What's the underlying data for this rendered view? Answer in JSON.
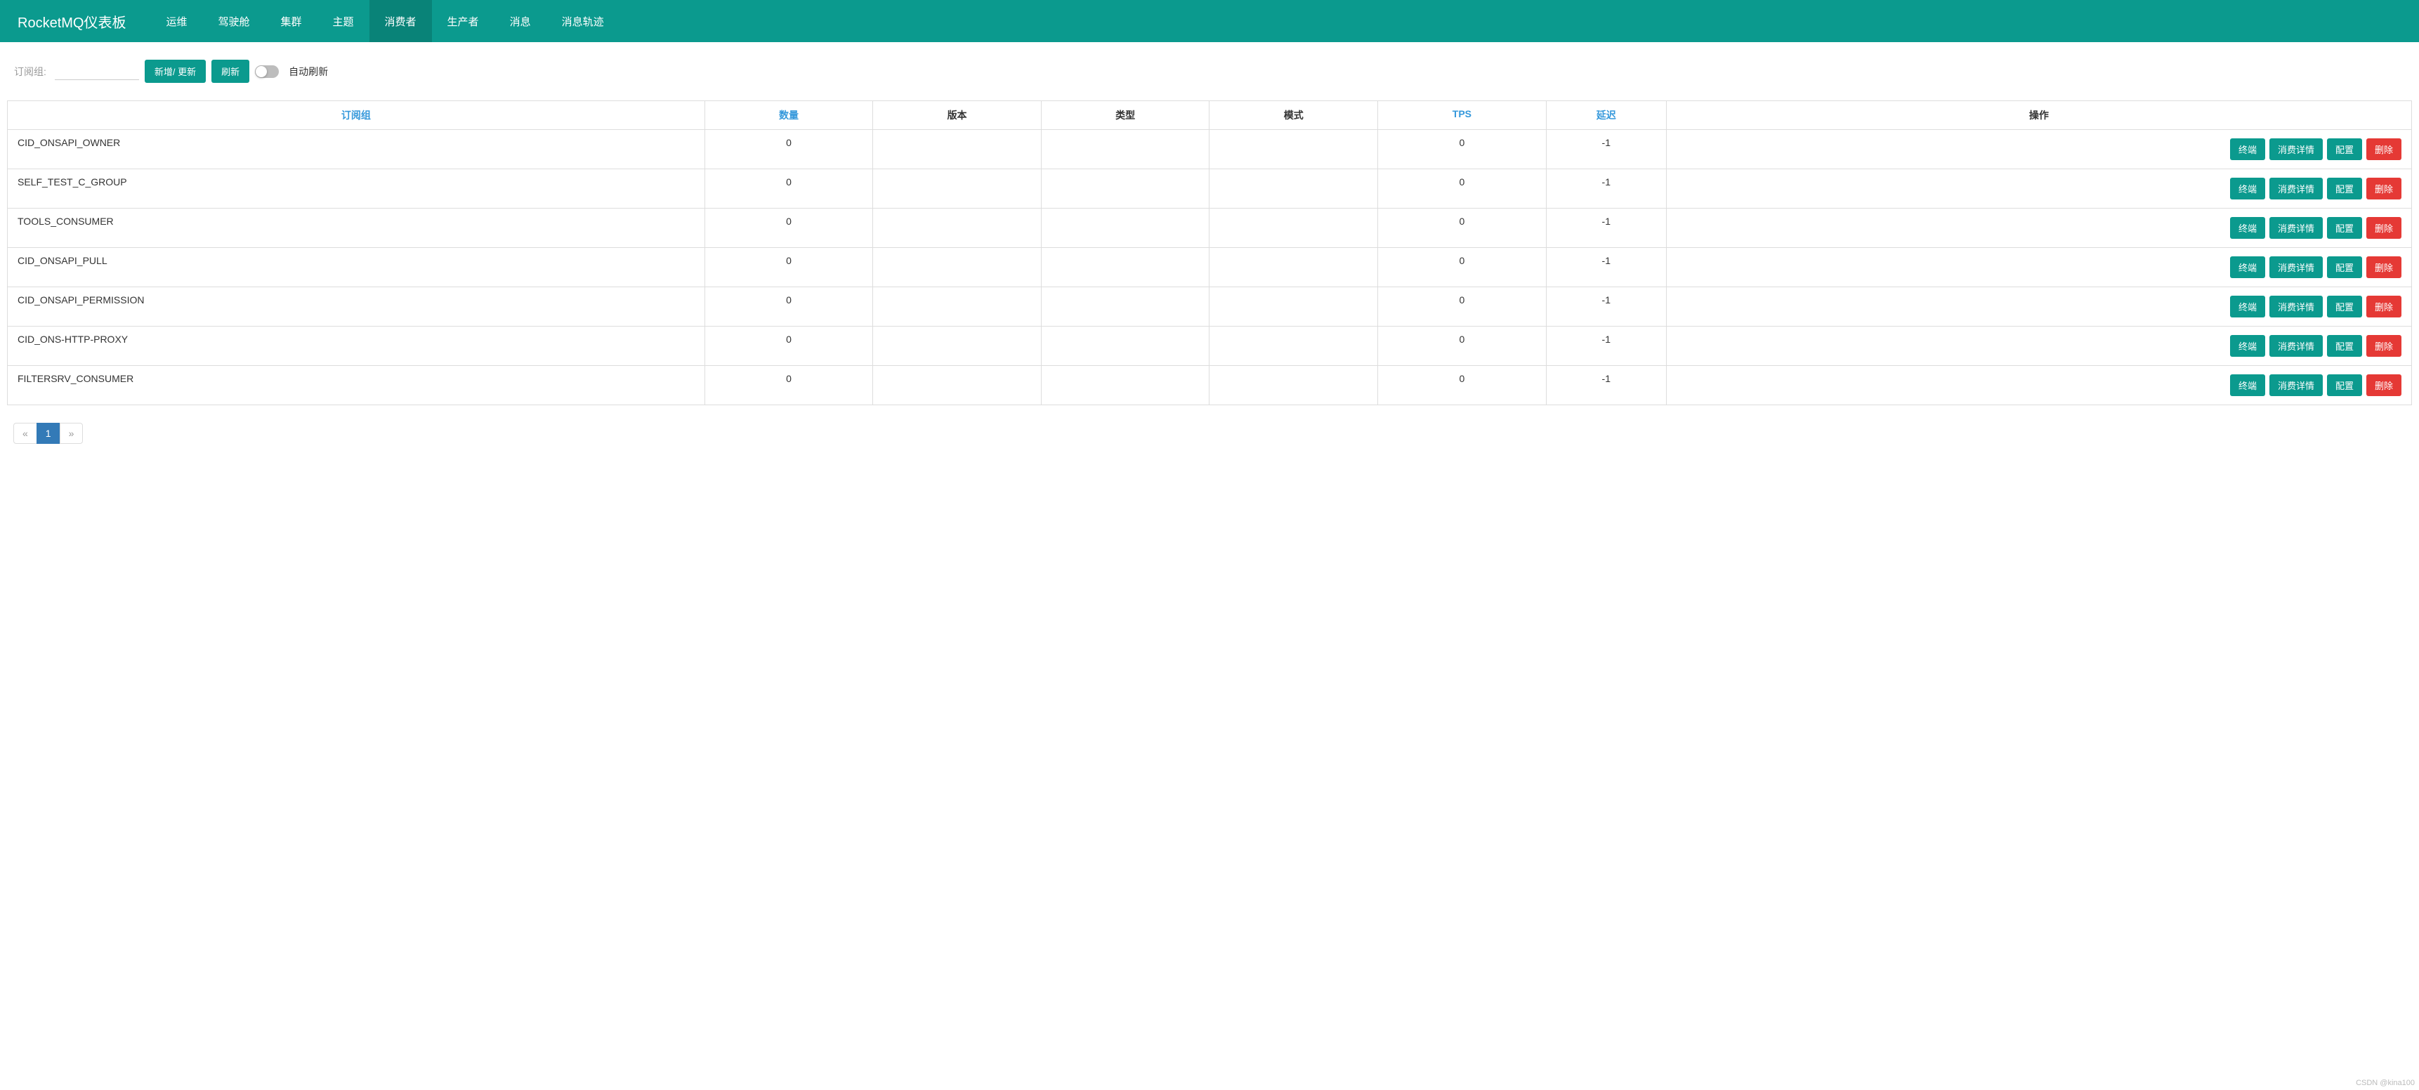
{
  "brand": "RocketMQ仪表板",
  "nav": [
    {
      "label": "运维",
      "active": false
    },
    {
      "label": "驾驶舱",
      "active": false
    },
    {
      "label": "集群",
      "active": false
    },
    {
      "label": "主题",
      "active": false
    },
    {
      "label": "消费者",
      "active": true
    },
    {
      "label": "生产者",
      "active": false
    },
    {
      "label": "消息",
      "active": false
    },
    {
      "label": "消息轨迹",
      "active": false
    }
  ],
  "toolbar": {
    "filter_label": "订阅组:",
    "filter_value": "",
    "add_update_label": "新增/ 更新",
    "refresh_label": "刷新",
    "auto_refresh_label": "自动刷新",
    "auto_refresh_on": false
  },
  "columns": {
    "group": "订阅组",
    "quantity": "数量",
    "version": "版本",
    "type": "类型",
    "mode": "模式",
    "tps": "TPS",
    "delay": "延迟",
    "actions": "操作"
  },
  "action_labels": {
    "terminal": "终端",
    "consume_detail": "消费详情",
    "config": "配置",
    "delete": "删除"
  },
  "rows": [
    {
      "group": "CID_ONSAPI_OWNER",
      "quantity": "0",
      "version": "",
      "type": "",
      "mode": "",
      "tps": "0",
      "delay": "-1"
    },
    {
      "group": "SELF_TEST_C_GROUP",
      "quantity": "0",
      "version": "",
      "type": "",
      "mode": "",
      "tps": "0",
      "delay": "-1"
    },
    {
      "group": "TOOLS_CONSUMER",
      "quantity": "0",
      "version": "",
      "type": "",
      "mode": "",
      "tps": "0",
      "delay": "-1"
    },
    {
      "group": "CID_ONSAPI_PULL",
      "quantity": "0",
      "version": "",
      "type": "",
      "mode": "",
      "tps": "0",
      "delay": "-1"
    },
    {
      "group": "CID_ONSAPI_PERMISSION",
      "quantity": "0",
      "version": "",
      "type": "",
      "mode": "",
      "tps": "0",
      "delay": "-1"
    },
    {
      "group": "CID_ONS-HTTP-PROXY",
      "quantity": "0",
      "version": "",
      "type": "",
      "mode": "",
      "tps": "0",
      "delay": "-1"
    },
    {
      "group": "FILTERSRV_CONSUMER",
      "quantity": "0",
      "version": "",
      "type": "",
      "mode": "",
      "tps": "0",
      "delay": "-1"
    }
  ],
  "pagination": {
    "prev": "«",
    "next": "»",
    "current": "1"
  },
  "watermark": "CSDN @kina100"
}
